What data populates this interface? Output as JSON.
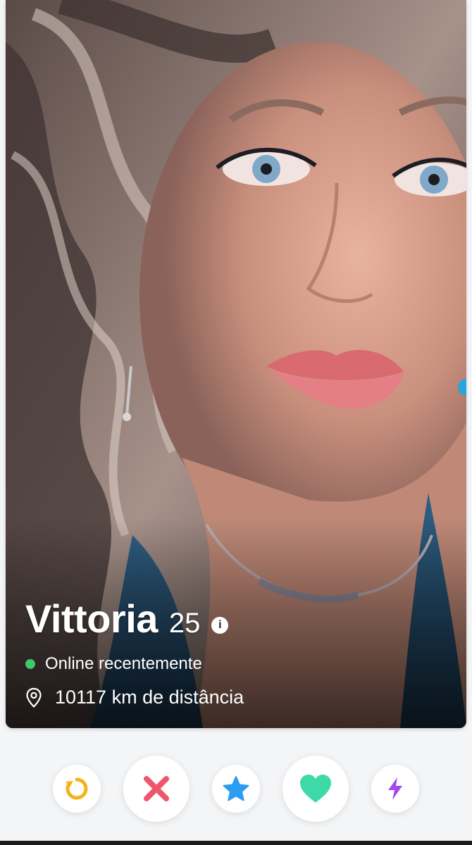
{
  "profile": {
    "name": "Vittoria",
    "age": "25",
    "info_icon": "i",
    "status": "Online recentemente",
    "distance": "10117 km de distância"
  },
  "actions": [
    {
      "name": "rewind-button",
      "icon": "rewind-icon",
      "color": "#f5b21a"
    },
    {
      "name": "nope-button",
      "icon": "close-icon",
      "color": "#f0566b"
    },
    {
      "name": "super-like-button",
      "icon": "star-icon",
      "color": "#2b9df2"
    },
    {
      "name": "like-button",
      "icon": "heart-icon",
      "color": "#3ed9a6"
    },
    {
      "name": "boost-button",
      "icon": "lightning-icon",
      "color": "#a14ae8"
    }
  ],
  "colors": {
    "online": "#3ec76b",
    "background": "#f4f5f7"
  }
}
